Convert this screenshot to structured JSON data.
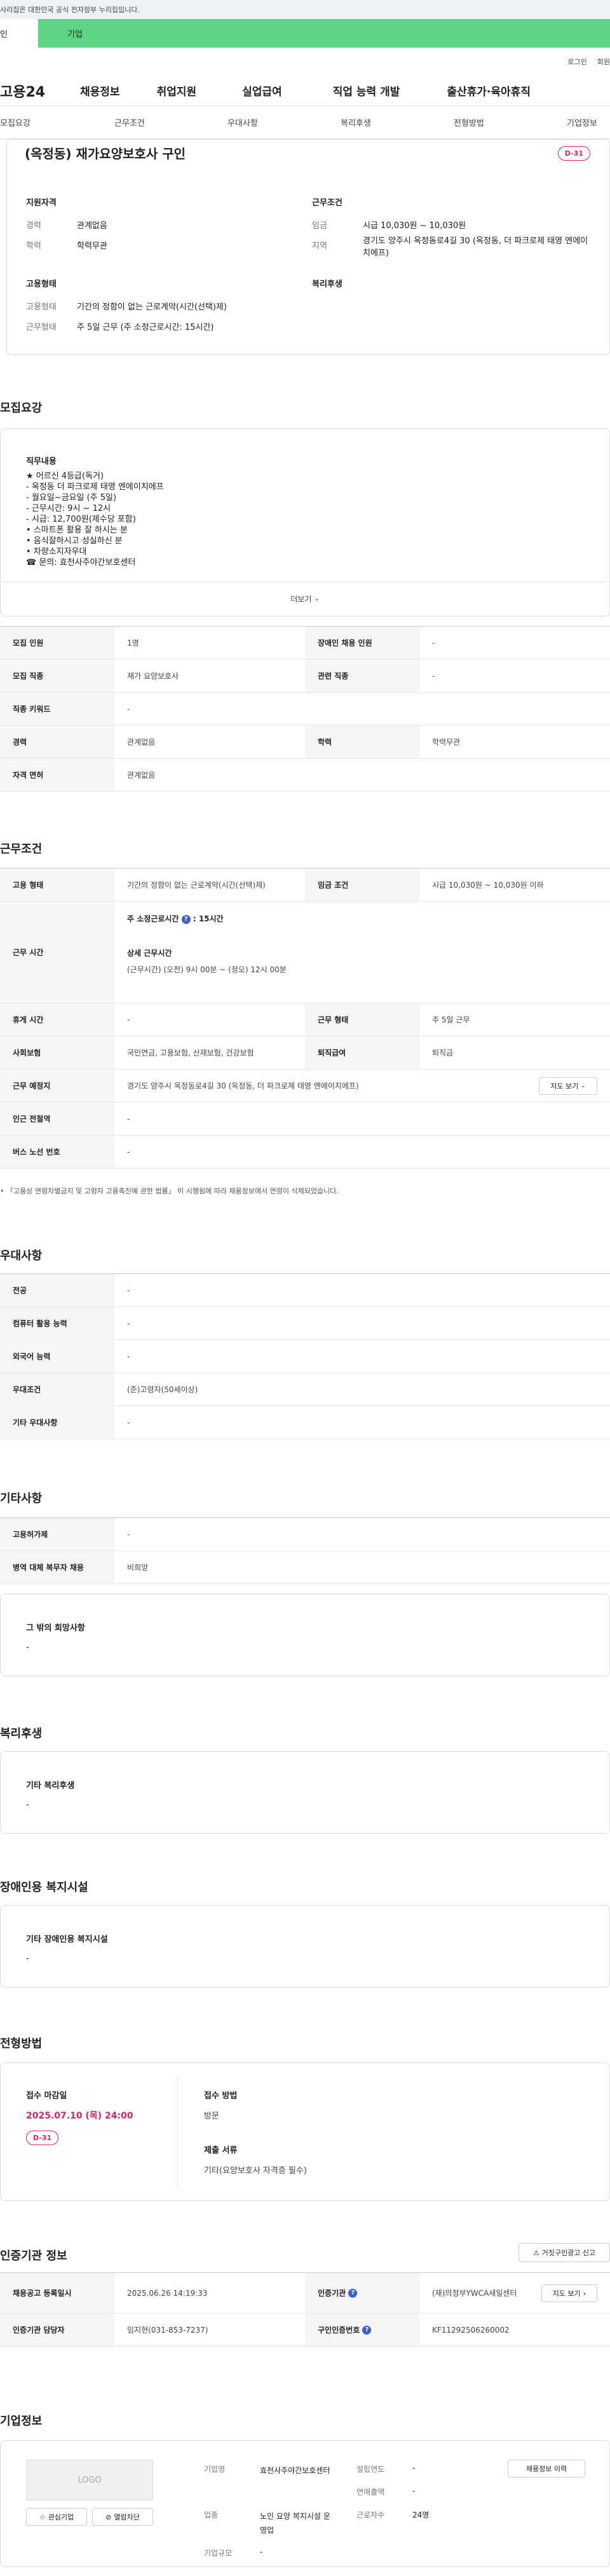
{
  "gov_banner": "사리집은 대한민국 공식 전자정부 누리집입니다.",
  "tabs": {
    "personal": "인",
    "company": "기업"
  },
  "top_links": {
    "login": "로그인",
    "join": "회원"
  },
  "gnb": {
    "logo": "고용24",
    "menu": [
      "채용정보",
      "취업지원",
      "실업급여",
      "직업 능력 개발",
      "출산휴가·육아휴직"
    ]
  },
  "subnav": [
    "모집요강",
    "근무조건",
    "우대사항",
    "복리후생",
    "전형방법",
    "기업정보"
  ],
  "summary": {
    "title": "(옥정동) 재가요양보호사 구인",
    "dday": "D-31",
    "qual_title": "지원자격",
    "qual": [
      {
        "k": "경력",
        "v": "관계없음"
      },
      {
        "k": "학력",
        "v": "학력무관"
      }
    ],
    "cond_title": "근무조건",
    "cond": [
      {
        "k": "임금",
        "v": "시급 10,030원 ~ 10,030원"
      },
      {
        "k": "지역",
        "v": "경기도 양주시 옥정동로4길 30 (옥정동, 더 파크로제 태영 엔에이치에프)"
      }
    ],
    "emp_title": "고용형태",
    "emp": [
      {
        "k": "고용형태",
        "v": "기간의 정함이 없는 근로계약(시간(선택)제)"
      },
      {
        "k": "근무형태",
        "v": "주 5일 근무 (주 소정근로시간: 15시간)"
      }
    ],
    "welfare_title": "복리후생"
  },
  "recruit": {
    "heading": "모집요강",
    "duty_title": "직무내용",
    "duty_lines": [
      "★ 어르신 4등급(독거)",
      "- 옥정동 더 파크로제 태영 엔에이치에프",
      "- 월요일~금요일 (주 5일)",
      "- 근무시간: 9시 ~ 12시",
      "- 시급: 12,700원(제수당 포함)",
      "• 스마트폰 활용 잘 하시는 분",
      "• 음식잘하시고 성실하신 분",
      "• 차량소지자우대",
      "☎ 문의: 효천사주야간보호센터"
    ],
    "more": "더보기",
    "rows": [
      [
        {
          "th": "모집 인원",
          "td": "1명"
        },
        {
          "th": "장애인 채용 인원",
          "td": "-"
        }
      ],
      [
        {
          "th": "모집 직종",
          "td": "재가 요양보호사"
        },
        {
          "th": "관련 직종",
          "td": "-"
        }
      ],
      [
        {
          "th": "직종 키워드",
          "td": "-"
        }
      ],
      [
        {
          "th": "경력",
          "td": "관계없음"
        },
        {
          "th": "학력",
          "td": "학력무관"
        }
      ],
      [
        {
          "th": "자격 면허",
          "td": "관계없음"
        }
      ]
    ]
  },
  "work": {
    "heading": "근무조건",
    "emp_th": "고용 형태",
    "emp_td": "기간의 정함이 없는 근로계약(시간(선택)제)",
    "wage_th": "임금 조건",
    "wage_td": "시급 10,030원 ~ 10,030원 이하",
    "hours_th": "근무 시간",
    "hours_weekly": "주 소정근로시간",
    "hours_weekly_val": ": 15시간",
    "hours_detail_title": "상세 근무시간",
    "hours_detail": "(근무시간) (오전) 9시 00분 ~ (정오) 12시 00분",
    "leave_th": "휴게 시간",
    "leave_td": "-",
    "form_th": "근무 형태",
    "form_td": "주 5일 근무",
    "ins_th": "사회보험",
    "ins_td": "국민연금, 고용보험, 산재보험, 건강보험",
    "ret_th": "퇴직급여",
    "ret_td": "퇴직금",
    "place_th": "근무 예정지",
    "place_td": "경기도 양주시 옥정동로4길 30 (옥정동, 더 파크로제 태영 엔에이치에프)",
    "map_btn": "지도 보기",
    "station_th": "인근 전철역",
    "station_td": "-",
    "bus_th": "버스 노선 번호",
    "bus_td": "-",
    "note": "• 「고용상 연령차별금지 및 고령자 고용촉진에 관한 법률」 이 시행됨에 따라 채용정보에서 연령이 삭제되었습니다."
  },
  "pref": {
    "heading": "우대사항",
    "rows": [
      {
        "th": "전공",
        "td": "-"
      },
      {
        "th": "컴퓨터 활용 능력",
        "td": "-"
      },
      {
        "th": "외국어 능력",
        "td": "-"
      },
      {
        "th": "우대조건",
        "td": "(준)고령자(50세이상)"
      },
      {
        "th": "기타 우대사항",
        "td": "-"
      }
    ]
  },
  "etc": {
    "heading": "기타사항",
    "rows": [
      {
        "th": "고용허가제",
        "td": "-"
      },
      {
        "th": "병역 대체 복무자 채용",
        "td": "비희망"
      }
    ],
    "box_title": "그 밖의 희망사항",
    "box_val": "-"
  },
  "welfare": {
    "heading": "복리후생",
    "box_title": "기타 복리후생",
    "box_val": "-"
  },
  "disabled": {
    "heading": "장애인용 복지시설",
    "box_title": "기타 장애인용 복지시설",
    "box_val": "-"
  },
  "selection": {
    "heading": "전형방법",
    "deadline_title": "접수 마감일",
    "deadline": "2025.07.10 (목) 24:00",
    "dday": "D-31",
    "method_title": "접수 방법",
    "method": "방문",
    "docs_title": "제출 서류",
    "docs": "기타(요양보호사 자격증 필수)"
  },
  "cert": {
    "heading": "인증기관 정보",
    "report_btn": "거짓구인광고 신고",
    "reg_th": "채용공고 등록일시",
    "reg_td": "2025.06.26 14:19:33",
    "org_th": "인증기관",
    "org_td": "(재)의정부YWCA새일센터",
    "map_btn": "지도 보기",
    "mgr_th": "인증기관 담당자",
    "mgr_td": "임지현(031-853-7237)",
    "id_th": "구인인증번호",
    "id_td": "KF11292506260002"
  },
  "company": {
    "heading": "기업정보",
    "logo": "LOGO",
    "fav_btn": "관심기업",
    "block_btn": "열람차단",
    "name_k": "기업명",
    "name_v": "효천사주야간보호센터",
    "biz_k": "업종",
    "biz_v": "노인 요양 복지시설 운영업",
    "size_k": "기업규모",
    "size_v": "-",
    "est_k": "설립연도",
    "est_v": "-",
    "sales_k": "연매출액",
    "sales_v": "-",
    "emp_k": "근로자수",
    "emp_v": "24명",
    "history_btn": "채용정보 이력"
  }
}
